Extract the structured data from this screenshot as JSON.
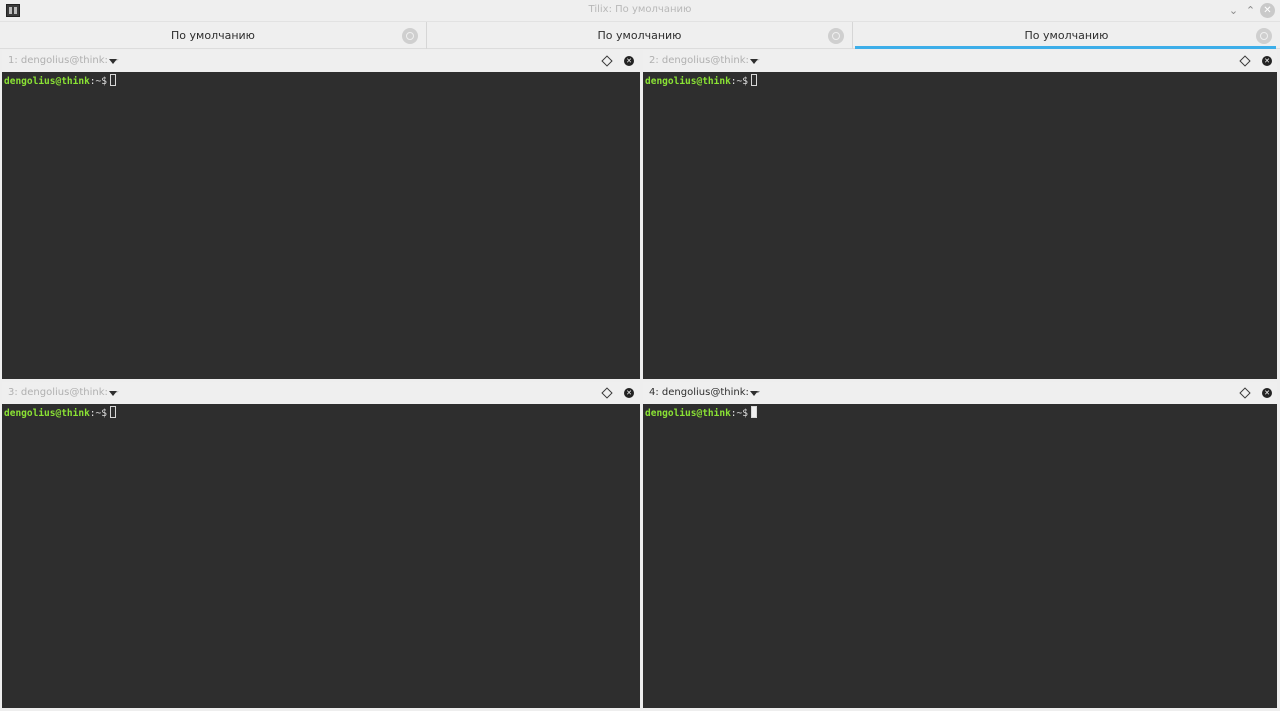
{
  "window": {
    "title": "Tilix: По умолчанию"
  },
  "sessions": [
    {
      "label": "По умолчанию"
    },
    {
      "label": "По умолчанию"
    },
    {
      "label": "По умолчанию",
      "active": true
    }
  ],
  "panes": [
    {
      "title": "1: dengolius@think: ~",
      "prompt_user": "dengolius@think",
      "prompt_path": ":~$",
      "focused": false
    },
    {
      "title": "2: dengolius@think: ~",
      "prompt_user": "dengolius@think",
      "prompt_path": ":~$",
      "focused": false
    },
    {
      "title": "3: dengolius@think: ~",
      "prompt_user": "dengolius@think",
      "prompt_path": ":~$",
      "focused": false
    },
    {
      "title": "4: dengolius@think: ~",
      "prompt_user": "dengolius@think",
      "prompt_path": ":~$",
      "focused": true
    }
  ],
  "colors": {
    "accent": "#3daee9",
    "terminal_bg": "#2e2e2e",
    "prompt_user": "#8ae234"
  }
}
